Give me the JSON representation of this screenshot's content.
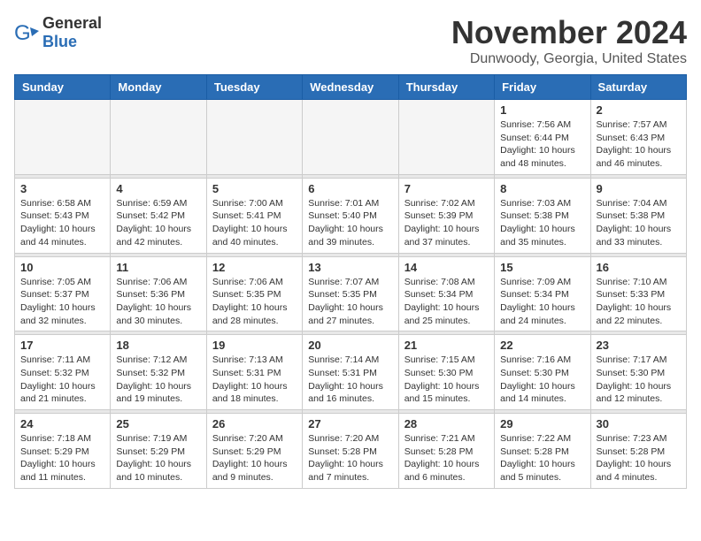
{
  "logo": {
    "text_general": "General",
    "text_blue": "Blue"
  },
  "title": "November 2024",
  "location": "Dunwoody, Georgia, United States",
  "days_of_week": [
    "Sunday",
    "Monday",
    "Tuesday",
    "Wednesday",
    "Thursday",
    "Friday",
    "Saturday"
  ],
  "weeks": [
    {
      "days": [
        {
          "num": "",
          "info": "",
          "empty": true
        },
        {
          "num": "",
          "info": "",
          "empty": true
        },
        {
          "num": "",
          "info": "",
          "empty": true
        },
        {
          "num": "",
          "info": "",
          "empty": true
        },
        {
          "num": "",
          "info": "",
          "empty": true
        },
        {
          "num": "1",
          "info": "Sunrise: 7:56 AM\nSunset: 6:44 PM\nDaylight: 10 hours\nand 48 minutes."
        },
        {
          "num": "2",
          "info": "Sunrise: 7:57 AM\nSunset: 6:43 PM\nDaylight: 10 hours\nand 46 minutes."
        }
      ]
    },
    {
      "days": [
        {
          "num": "3",
          "info": "Sunrise: 6:58 AM\nSunset: 5:43 PM\nDaylight: 10 hours\nand 44 minutes."
        },
        {
          "num": "4",
          "info": "Sunrise: 6:59 AM\nSunset: 5:42 PM\nDaylight: 10 hours\nand 42 minutes."
        },
        {
          "num": "5",
          "info": "Sunrise: 7:00 AM\nSunset: 5:41 PM\nDaylight: 10 hours\nand 40 minutes."
        },
        {
          "num": "6",
          "info": "Sunrise: 7:01 AM\nSunset: 5:40 PM\nDaylight: 10 hours\nand 39 minutes."
        },
        {
          "num": "7",
          "info": "Sunrise: 7:02 AM\nSunset: 5:39 PM\nDaylight: 10 hours\nand 37 minutes."
        },
        {
          "num": "8",
          "info": "Sunrise: 7:03 AM\nSunset: 5:38 PM\nDaylight: 10 hours\nand 35 minutes."
        },
        {
          "num": "9",
          "info": "Sunrise: 7:04 AM\nSunset: 5:38 PM\nDaylight: 10 hours\nand 33 minutes."
        }
      ]
    },
    {
      "days": [
        {
          "num": "10",
          "info": "Sunrise: 7:05 AM\nSunset: 5:37 PM\nDaylight: 10 hours\nand 32 minutes."
        },
        {
          "num": "11",
          "info": "Sunrise: 7:06 AM\nSunset: 5:36 PM\nDaylight: 10 hours\nand 30 minutes."
        },
        {
          "num": "12",
          "info": "Sunrise: 7:06 AM\nSunset: 5:35 PM\nDaylight: 10 hours\nand 28 minutes."
        },
        {
          "num": "13",
          "info": "Sunrise: 7:07 AM\nSunset: 5:35 PM\nDaylight: 10 hours\nand 27 minutes."
        },
        {
          "num": "14",
          "info": "Sunrise: 7:08 AM\nSunset: 5:34 PM\nDaylight: 10 hours\nand 25 minutes."
        },
        {
          "num": "15",
          "info": "Sunrise: 7:09 AM\nSunset: 5:34 PM\nDaylight: 10 hours\nand 24 minutes."
        },
        {
          "num": "16",
          "info": "Sunrise: 7:10 AM\nSunset: 5:33 PM\nDaylight: 10 hours\nand 22 minutes."
        }
      ]
    },
    {
      "days": [
        {
          "num": "17",
          "info": "Sunrise: 7:11 AM\nSunset: 5:32 PM\nDaylight: 10 hours\nand 21 minutes."
        },
        {
          "num": "18",
          "info": "Sunrise: 7:12 AM\nSunset: 5:32 PM\nDaylight: 10 hours\nand 19 minutes."
        },
        {
          "num": "19",
          "info": "Sunrise: 7:13 AM\nSunset: 5:31 PM\nDaylight: 10 hours\nand 18 minutes."
        },
        {
          "num": "20",
          "info": "Sunrise: 7:14 AM\nSunset: 5:31 PM\nDaylight: 10 hours\nand 16 minutes."
        },
        {
          "num": "21",
          "info": "Sunrise: 7:15 AM\nSunset: 5:30 PM\nDaylight: 10 hours\nand 15 minutes."
        },
        {
          "num": "22",
          "info": "Sunrise: 7:16 AM\nSunset: 5:30 PM\nDaylight: 10 hours\nand 14 minutes."
        },
        {
          "num": "23",
          "info": "Sunrise: 7:17 AM\nSunset: 5:30 PM\nDaylight: 10 hours\nand 12 minutes."
        }
      ]
    },
    {
      "days": [
        {
          "num": "24",
          "info": "Sunrise: 7:18 AM\nSunset: 5:29 PM\nDaylight: 10 hours\nand 11 minutes."
        },
        {
          "num": "25",
          "info": "Sunrise: 7:19 AM\nSunset: 5:29 PM\nDaylight: 10 hours\nand 10 minutes."
        },
        {
          "num": "26",
          "info": "Sunrise: 7:20 AM\nSunset: 5:29 PM\nDaylight: 10 hours\nand 9 minutes."
        },
        {
          "num": "27",
          "info": "Sunrise: 7:20 AM\nSunset: 5:28 PM\nDaylight: 10 hours\nand 7 minutes."
        },
        {
          "num": "28",
          "info": "Sunrise: 7:21 AM\nSunset: 5:28 PM\nDaylight: 10 hours\nand 6 minutes."
        },
        {
          "num": "29",
          "info": "Sunrise: 7:22 AM\nSunset: 5:28 PM\nDaylight: 10 hours\nand 5 minutes."
        },
        {
          "num": "30",
          "info": "Sunrise: 7:23 AM\nSunset: 5:28 PM\nDaylight: 10 hours\nand 4 minutes."
        }
      ]
    }
  ]
}
